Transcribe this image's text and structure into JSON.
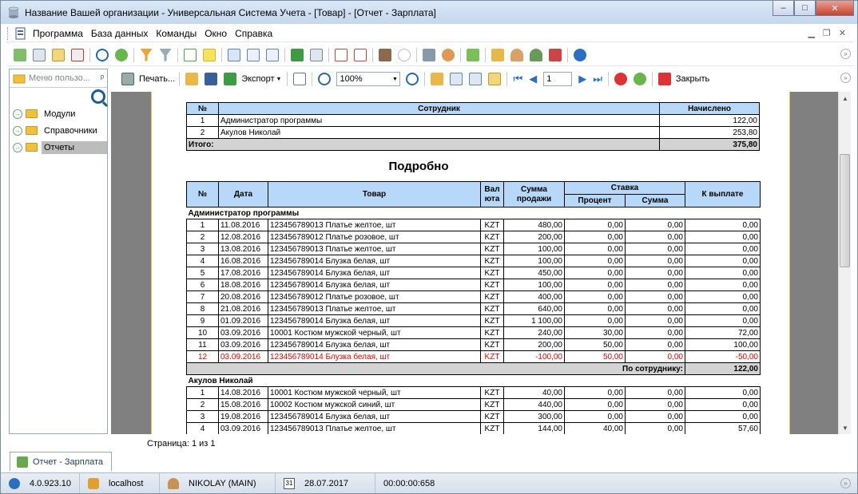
{
  "window": {
    "title": "Название Вашей организации - Универсальная Система Учета - [Товар] - [Отчет - Зарплата]",
    "buttons": {
      "minimize": "–",
      "maximize": "□",
      "close": "✕"
    }
  },
  "menu": [
    "Программа",
    "База данных",
    "Команды",
    "Окно",
    "Справка"
  ],
  "sidebar": {
    "header_placeholder": "Меню пользо...",
    "pin": "ᵖ",
    "items": [
      {
        "label": "Модули",
        "active": false
      },
      {
        "label": "Справочники",
        "active": false
      },
      {
        "label": "Отчеты",
        "active": true
      }
    ]
  },
  "report_toolbar": {
    "print_label": "Печать...",
    "export_label": "Экспорт",
    "zoom_value": "100%",
    "page_value": "1",
    "close_label": "Закрыть"
  },
  "summary_table": {
    "headers": [
      "№",
      "Сотрудник",
      "Начислено"
    ],
    "rows": [
      [
        "1",
        "Администратор программы",
        "122,00"
      ],
      [
        "2",
        "Акулов Николай",
        "253,80"
      ]
    ],
    "total_label": "Итого:",
    "total_value": "375,80"
  },
  "detail_heading": "Подробно",
  "detail_table": {
    "headers": {
      "num": "№",
      "date": "Дата",
      "product": "Товар",
      "currency": "Вал юта",
      "sale_sum": "Сумма продажи",
      "rate": "Ставка",
      "rate_percent": "Процент",
      "rate_sum": "Сумма",
      "payout": "К выплате"
    },
    "groups": [
      {
        "name": "Администратор программы",
        "rows": [
          [
            "1",
            "11.08.2016",
            "123456789013 Платье желтое, шт",
            "KZT",
            "480,00",
            "0,00",
            "0,00",
            "0,00"
          ],
          [
            "2",
            "12.08.2016",
            "123456789012 Платье розовое, шт",
            "KZT",
            "200,00",
            "0,00",
            "0,00",
            "0,00"
          ],
          [
            "3",
            "13.08.2016",
            "123456789013 Платье желтое, шт",
            "KZT",
            "100,00",
            "0,00",
            "0,00",
            "0,00"
          ],
          [
            "4",
            "16.08.2016",
            "123456789014 Блузка белая, шт",
            "KZT",
            "100,00",
            "0,00",
            "0,00",
            "0,00"
          ],
          [
            "5",
            "17.08.2016",
            "123456789014 Блузка белая, шт",
            "KZT",
            "450,00",
            "0,00",
            "0,00",
            "0,00"
          ],
          [
            "6",
            "18.08.2016",
            "123456789014 Блузка белая, шт",
            "KZT",
            "100,00",
            "0,00",
            "0,00",
            "0,00"
          ],
          [
            "7",
            "20.08.2016",
            "123456789012 Платье розовое, шт",
            "KZT",
            "400,00",
            "0,00",
            "0,00",
            "0,00"
          ],
          [
            "8",
            "21.08.2016",
            "123456789013 Платье желтое, шт",
            "KZT",
            "640,00",
            "0,00",
            "0,00",
            "0,00"
          ],
          [
            "9",
            "01.09.2016",
            "123456789014 Блузка белая, шт",
            "KZT",
            "1 100,00",
            "0,00",
            "0,00",
            "0,00"
          ],
          [
            "10",
            "03.09.2016",
            "10001 Костюм мужской черный, шт",
            "KZT",
            "240,00",
            "30,00",
            "0,00",
            "72,00"
          ],
          [
            "11",
            "03.09.2016",
            "123456789014 Блузка белая, шт",
            "KZT",
            "200,00",
            "50,00",
            "0,00",
            "100,00"
          ],
          [
            "12",
            "03.09.2016",
            "123456789014 Блузка белая, шт",
            "KZT",
            "-100,00",
            "50,00",
            "0,00",
            "-50,00"
          ]
        ],
        "red_row_index": 11,
        "subtotal_label": "По сотруднику:",
        "subtotal_value": "122,00"
      },
      {
        "name": "Акулов Николай",
        "rows": [
          [
            "1",
            "14.08.2016",
            "10001 Костюм мужской черный, шт",
            "KZT",
            "40,00",
            "0,00",
            "0,00",
            "0,00"
          ],
          [
            "2",
            "15.08.2016",
            "10002 Костюм мужской синий, шт",
            "KZT",
            "440,00",
            "0,00",
            "0,00",
            "0,00"
          ],
          [
            "3",
            "19.08.2016",
            "123456789014 Блузка белая, шт",
            "KZT",
            "300,00",
            "0,00",
            "0,00",
            "0,00"
          ],
          [
            "4",
            "03.09.2016",
            "123456789013 Платье желтое, шт",
            "KZT",
            "144,00",
            "40,00",
            "0,00",
            "57,60"
          ]
        ]
      }
    ]
  },
  "page_info": "Страница: 1 из 1",
  "doc_tab": "Отчет - Зарплата",
  "status": {
    "version": "4.0.923.10",
    "server": "localhost",
    "user": "NIKOLAY (MAIN)",
    "date_icon_text": "31",
    "date": "28.07.2017",
    "timer": "00:00:00:658"
  },
  "colors": {
    "header_bg": "#b7d8f8",
    "total_bg": "#d3d3d3",
    "error_text": "#e60000",
    "viewer_bg": "#808080"
  }
}
